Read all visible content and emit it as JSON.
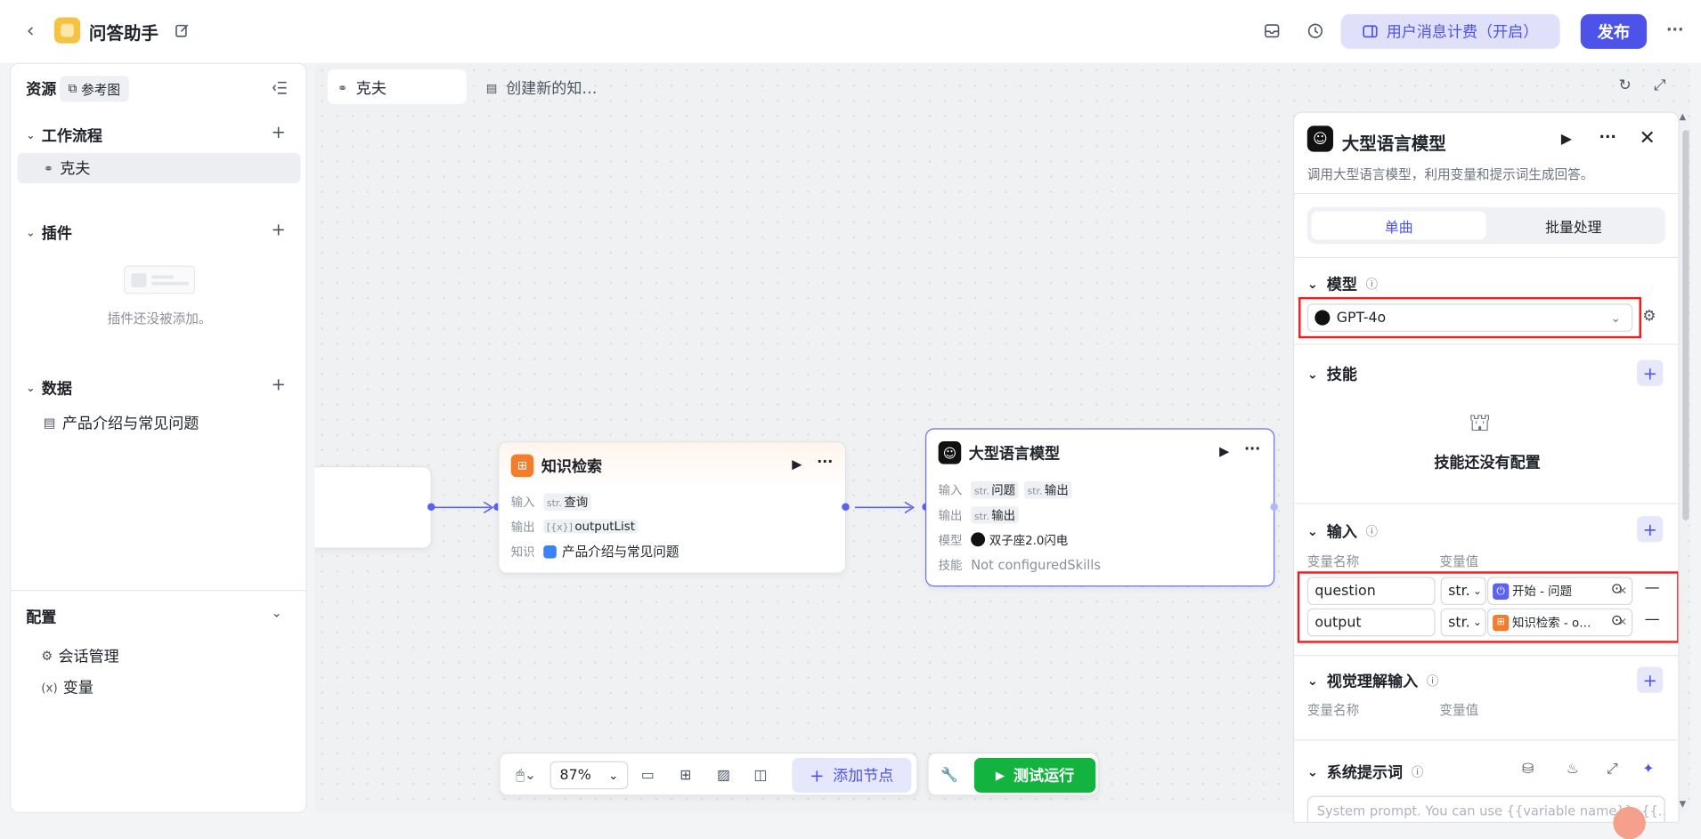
{
  "header": {
    "back_icon": "back-arrow-icon",
    "app_title": "问答助手",
    "billing_label": "用户消息计费（开启）",
    "publish_label": "发布",
    "more": "···"
  },
  "left": {
    "resources_label": "资源",
    "reference_label": "参考图",
    "workflow": {
      "title": "工作流程",
      "items": [
        "克夫"
      ]
    },
    "plugins": {
      "title": "插件",
      "empty_text": "插件还没被添加。"
    },
    "data": {
      "title": "数据",
      "items": [
        "产品介绍与常见问题"
      ]
    },
    "config": {
      "title": "配置",
      "items": [
        "会话管理",
        "变量"
      ]
    }
  },
  "canvas": {
    "tabs": [
      "克夫",
      "创建新的知…"
    ],
    "knowledge_node": {
      "title": "知识检索",
      "input_label": "输入",
      "input_type": "str.",
      "input_value": "查询",
      "output_label": "输出",
      "output_type": "[{x}]",
      "output_value": "outputList",
      "knowledge_label": "知识",
      "knowledge_value": "产品介绍与常见问题"
    },
    "llm_node": {
      "title": "大型语言模型",
      "input_label": "输入",
      "input_type1": "str.",
      "input_value1": "问题",
      "input_type2": "str.",
      "input_value2": "输出",
      "output_label": "输出",
      "output_type": "str.",
      "output_value": "输出",
      "model_label": "模型",
      "model_value": "双子座2.0闪电",
      "skills_label": "技能",
      "skills_value": "Not configuredSkills"
    },
    "toolbar": {
      "zoom": "87%",
      "add_node_label": "添加节点",
      "test_run_label": "测试运行"
    }
  },
  "panel": {
    "title": "大型语言模型",
    "description": "调用大型语言模型，利用变量和提示词生成回答。",
    "tabs": [
      "单曲",
      "批量处理"
    ],
    "model_section": "模型",
    "model_value": "GPT-4o",
    "skills_section": "技能",
    "skills_empty": "技能还没有配置",
    "input_section": "输入",
    "var_name_header": "变量名称",
    "var_value_header": "变量值",
    "inputs": [
      {
        "name": "question",
        "type": "str.",
        "source": "开始 - 问题"
      },
      {
        "name": "output",
        "type": "str.",
        "source": "知识检索 - o…"
      }
    ],
    "vision_section": "视觉理解输入",
    "vision_name_header": "变量名称",
    "vision_value_header": "变量值",
    "system_prompt_section": "系统提示词",
    "system_prompt_placeholder": "System prompt. You can use {{variable name}}, {{...}}"
  },
  "colors": {
    "accent": "#4d53e8",
    "highlight": "#ee1d1d",
    "run_button": "#12b33f",
    "knowledge_icon": "#f27d2c"
  }
}
